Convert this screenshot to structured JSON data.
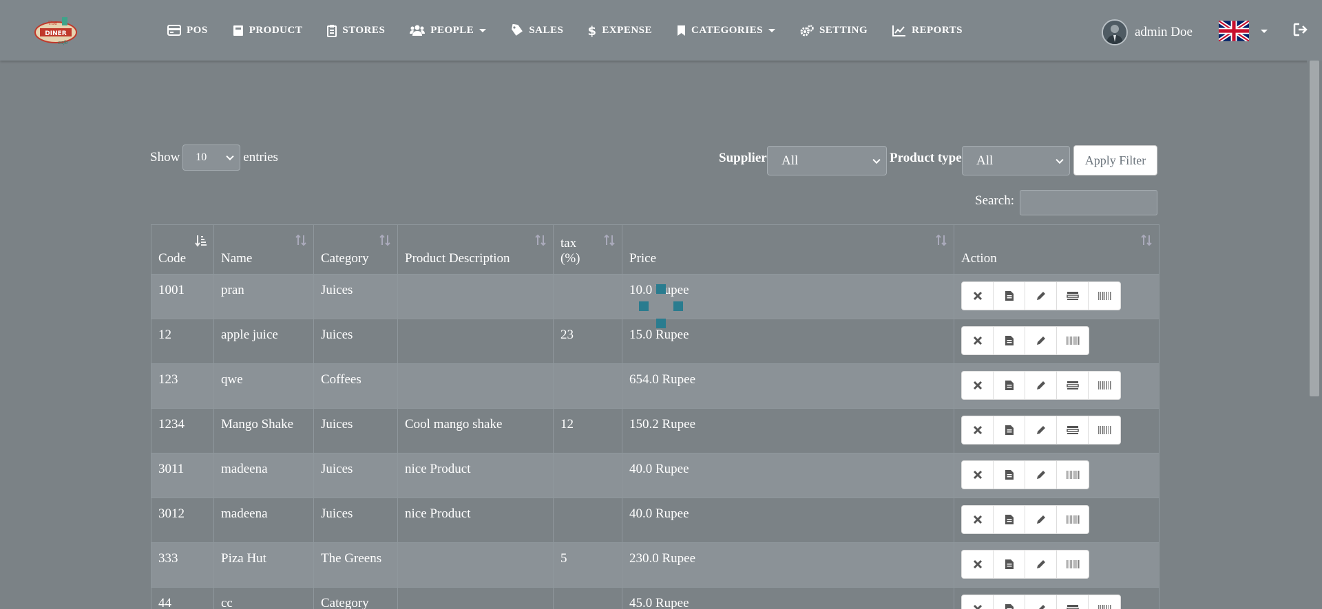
{
  "nav": {
    "items": [
      {
        "label": "POS",
        "icon": "credit-card-icon"
      },
      {
        "label": "PRODUCT",
        "icon": "product-icon"
      },
      {
        "label": "STORES",
        "icon": "clipboard-icon"
      },
      {
        "label": "PEOPLE",
        "icon": "users-icon"
      },
      {
        "label": "SALES",
        "icon": "tag-icon"
      },
      {
        "label": "EXPENSE",
        "icon": "dollar-icon"
      },
      {
        "label": "CATEGORIES",
        "icon": "bookmark-icon"
      },
      {
        "label": "SETTING",
        "icon": "cogs-icon"
      },
      {
        "label": "REPORTS",
        "icon": "line-chart-icon"
      }
    ],
    "user_name": "admin Doe"
  },
  "logo_text": "The DINER cafe",
  "controls": {
    "show_label": "Show",
    "entries_value": "10",
    "entries_label": "entries",
    "supplier_label": "Supplier",
    "supplier_value": "All",
    "product_type_label": "Product type",
    "product_type_value": "All",
    "apply_label": "Apply Filter",
    "search_label": "Search:"
  },
  "table": {
    "headers": {
      "code": "Code",
      "name": "Name",
      "category": "Category",
      "description": "Product Description",
      "tax_line1": "tax",
      "tax_line2": "(%)",
      "price": "Price",
      "action": "Action"
    },
    "rows": [
      {
        "code": "1001",
        "name": "pran",
        "category": "Juices",
        "description": "",
        "tax": "",
        "price": "10.0 Rupee",
        "actions": 5
      },
      {
        "code": "12",
        "name": "apple juice",
        "category": "Juices",
        "description": "",
        "tax": "23",
        "price": "15.0 Rupee",
        "actions": 4
      },
      {
        "code": "123",
        "name": "qwe",
        "category": "Coffees",
        "description": "",
        "tax": "",
        "price": "654.0 Rupee",
        "actions": 5
      },
      {
        "code": "1234",
        "name": "Mango Shake",
        "category": "Juices",
        "description": "Cool mango shake",
        "tax": "12",
        "price": "150.2 Rupee",
        "actions": 5
      },
      {
        "code": "3011",
        "name": "madeena",
        "category": "Juices",
        "description": "nice Product",
        "tax": "",
        "price": "40.0 Rupee",
        "actions": 4
      },
      {
        "code": "3012",
        "name": "madeena",
        "category": "Juices",
        "description": "nice Product",
        "tax": "",
        "price": "40.0 Rupee",
        "actions": 4
      },
      {
        "code": "333",
        "name": "Piza Hut",
        "category": "The Greens",
        "description": "",
        "tax": "5",
        "price": "230.0 Rupee",
        "actions": 4
      },
      {
        "code": "44",
        "name": "cc",
        "category": "Category",
        "description": "",
        "tax": "",
        "price": "45.0 Rupee",
        "actions": 5
      }
    ]
  },
  "colors": {
    "background": "#7b8286",
    "navbar": "#7f878c",
    "spinner": "#2a7c8f"
  }
}
